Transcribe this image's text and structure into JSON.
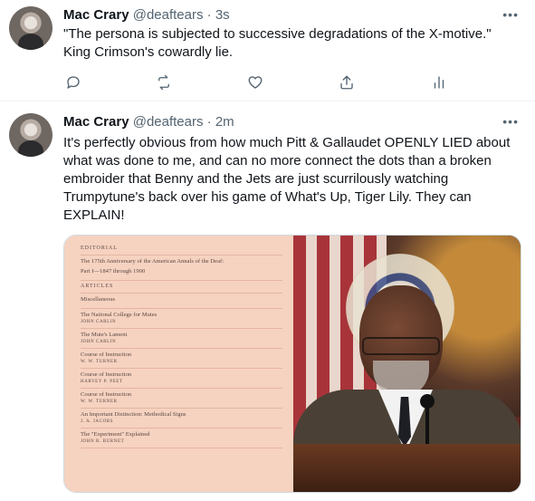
{
  "tweets": [
    {
      "name": "Mac Crary",
      "handle": "@deaftears",
      "separator": "·",
      "time": "3s",
      "more": "•••",
      "lines": [
        "\"The persona is subjected to successive degradations of the X-motive.\"",
        "King Crimson's cowardly lie."
      ],
      "actions": [
        "reply-icon",
        "retweet-icon",
        "like-icon",
        "share-icon",
        "analytics-icon"
      ]
    },
    {
      "name": "Mac Crary",
      "handle": "@deaftears",
      "separator": "·",
      "time": "2m",
      "more": "•••",
      "lines": [
        "It's perfectly obvious from how much Pitt & Gallaudet OPENLY LIED about",
        "what was done to me, and can no more connect the dots than a broken",
        "embroider that Benny and the Jets are just scurrilously watching",
        "Trumpytune's back over his game of What's Up, Tiger Lily. They can",
        "EXPLAIN!"
      ],
      "media": {
        "document": {
          "rows": [
            {
              "kind": "head",
              "title": "Editorial"
            },
            {
              "kind": "item",
              "title": "The 175th Anniversary of the American Annals of the Deaf:",
              "title2": "Part I—1847 through 1900"
            },
            {
              "kind": "head",
              "title": "Articles"
            },
            {
              "kind": "item",
              "title": "Miscellaneous"
            },
            {
              "kind": "item",
              "title": "The National College for Mutes",
              "author": "John Carlin"
            },
            {
              "kind": "item",
              "title": "The Mute's Lament",
              "author": "John Carlin"
            },
            {
              "kind": "item",
              "title": "Course of Instruction",
              "author": "W. W. Turner"
            },
            {
              "kind": "item",
              "title": "Course of Instruction",
              "author": "Harvey P. Peet"
            },
            {
              "kind": "item",
              "title": "Course of Instruction",
              "author": "W. W. Turner"
            },
            {
              "kind": "item",
              "title": "An Important Distinction: Methodical Signs",
              "author": "J. A. Jacobs"
            },
            {
              "kind": "item",
              "title": "The \"Experiment\" Explained",
              "author": "John R. Burnet"
            }
          ]
        }
      }
    }
  ],
  "colors": {
    "text": "#0f1419",
    "secondary": "#536471",
    "border": "#eff3f4",
    "document_bg": "#f6d2c0"
  }
}
